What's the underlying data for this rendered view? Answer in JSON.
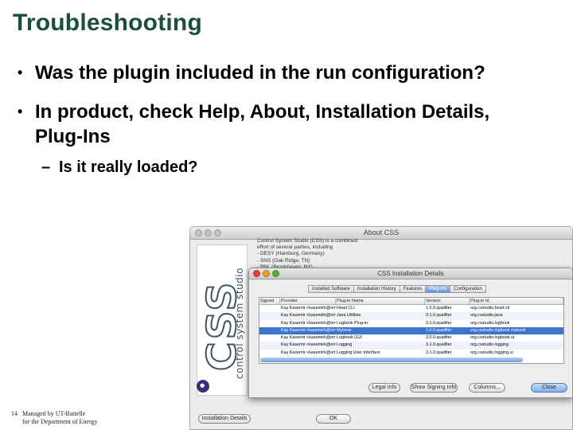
{
  "slide": {
    "title": "Troubleshooting",
    "bullet_1": "Was the plugin included in the run configuration?",
    "bullet_2": "In product, check Help, About, Installation Details, Plug-Ins",
    "sub_bullet_1": "Is it really loaded?",
    "bullet_glyph": "•",
    "dash_glyph": "–",
    "page_number": "14",
    "footer_line_1": "Managed by UT-Battelle",
    "footer_line_2": "for the Department of Energy"
  },
  "about_dialog": {
    "title": "About CSS",
    "logo_text": "CSS",
    "logo_subtext": "control system studio",
    "description_lines": [
      "Control System Studio (CSS) is a combined",
      "effort of several parties, including",
      "- DESY (Hamburg, Germany)",
      "- SNS (Oak Ridge, TN)",
      "- BNL (Brookhaven, NY)"
    ],
    "installation_details_label": "Installation Details",
    "ok_label": "OK"
  },
  "installation_dialog": {
    "title": "CSS Installation Details",
    "tabs": [
      "Installed Software",
      "Installation History",
      "Features",
      "Plug-ins",
      "Configuration"
    ],
    "active_tab": "Plug-ins",
    "columns": [
      "Signed",
      "Provider",
      "Plug-in Name",
      "Version",
      "Plug-in Id"
    ],
    "rows": [
      {
        "signed": "",
        "provider": "Kay Kasemir <kasemirk@orn...",
        "name": "Head CLI",
        "version": "1.0.0.qualifier",
        "id": "org.csstudio.head.cli"
      },
      {
        "signed": "",
        "provider": "Kay Kasemir <kasemirk@orn...",
        "name": "Java Utilities",
        "version": "3.1.0.qualifier",
        "id": "org.csstudio.java"
      },
      {
        "signed": "",
        "provider": "Kay Kasemir <kasemirk@orn...",
        "name": "Logbook Plug-in",
        "version": "3.1.0.qualifier",
        "id": "org.csstudio.logbook"
      },
      {
        "signed": "",
        "provider": "Kay Kasemir <kasemirk@orn...",
        "name": "Mybook",
        "version": "1.0.0.qualifier",
        "id": "org.csstudio.logbook.mybook"
      },
      {
        "signed": "",
        "provider": "Kay Kasemir <kasemirk@orn...",
        "name": "Logbook GUI",
        "version": "3.0.0.qualifier",
        "id": "org.csstudio.logbook.ui"
      },
      {
        "signed": "",
        "provider": "Kay Kasemir <kasemirk@orn...",
        "name": "Logging",
        "version": "3.1.0.qualifier",
        "id": "org.csstudio.logging"
      },
      {
        "signed": "",
        "provider": "Kay Kasemir <kasemirk@orn...",
        "name": "Logging User Interface",
        "version": "3.1.0.qualifier",
        "id": "org.csstudio.logging.ui"
      }
    ],
    "selected_row": 3,
    "buttons": {
      "legal_info": "Legal Info",
      "show_signing_info": "Show Signing Info",
      "columns": "Columns...",
      "close": "Close"
    }
  },
  "colors": {
    "title": "#1a4f3a",
    "selection": "#3d74cd",
    "logo": "#3b5566"
  }
}
